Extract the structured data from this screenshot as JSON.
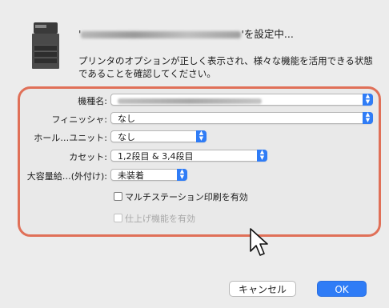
{
  "dialog": {
    "title_suffix": "'を設定中...",
    "title_prefix": "'",
    "description": "プリンタのオプションが正しく表示され、様々な機能を活用できる状態であることを確認してください。"
  },
  "options": {
    "model": {
      "label": "機種名:"
    },
    "finisher": {
      "label": "フィニッシャ:",
      "value": "なし"
    },
    "hole_unit": {
      "label": "ホール…ユニット:",
      "value": "なし"
    },
    "cassette": {
      "label": "カセット:",
      "value": "1,2段目 & 3,4段目"
    },
    "lcf": {
      "label": "大容量給…(外付け):",
      "value": "未装着"
    },
    "multi_station": {
      "label": "マルチステーション印刷を有効",
      "checked": false
    },
    "finishing": {
      "label": "仕上げ機能を有効",
      "checked": false,
      "disabled": true
    }
  },
  "buttons": {
    "cancel": "キャンセル",
    "ok": "OK"
  },
  "colors": {
    "accent": "#2f7cf6",
    "highlight_border": "#e07058"
  }
}
